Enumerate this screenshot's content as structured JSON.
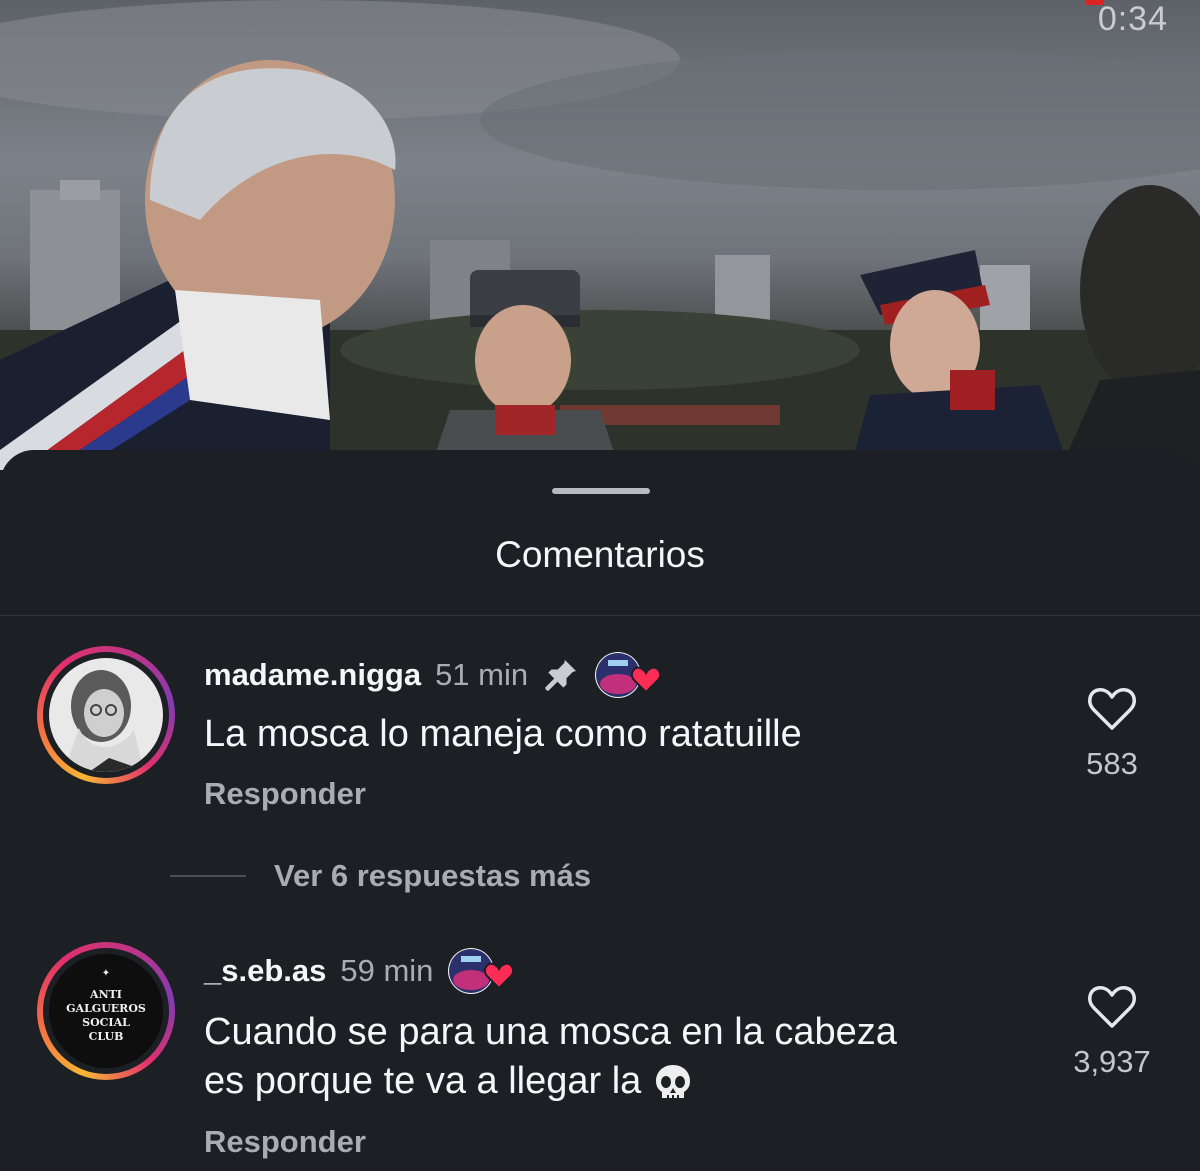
{
  "video": {
    "timer": "0:34"
  },
  "sheet": {
    "title": "Comentarios"
  },
  "comments": [
    {
      "username": "madame.nigga",
      "time": "51 min",
      "pinned": true,
      "text": "La mosca lo maneja como ratatuille",
      "reply_label": "Responder",
      "likes": "583",
      "more_replies": "Ver 6 respuestas más"
    },
    {
      "username": "_s.eb.as",
      "time": "59 min",
      "pinned": false,
      "text_line1": "Cuando se para una mosca en la cabeza",
      "text_line2": "es porque te va a llegar la",
      "avatar_text": [
        "ANTI",
        "GALGUEROS",
        "SOCIAL",
        "CLUB"
      ],
      "reply_label": "Responder",
      "likes": "3,937"
    }
  ],
  "icons": {
    "pin": "pin-icon",
    "heart": "heart-icon",
    "skull": "skull-icon",
    "badge_heart": "heart-badge-icon"
  },
  "colors": {
    "background": "#1c1f24",
    "secondary_text": "#a9acb2",
    "heart_badge": "#ff2d55"
  }
}
